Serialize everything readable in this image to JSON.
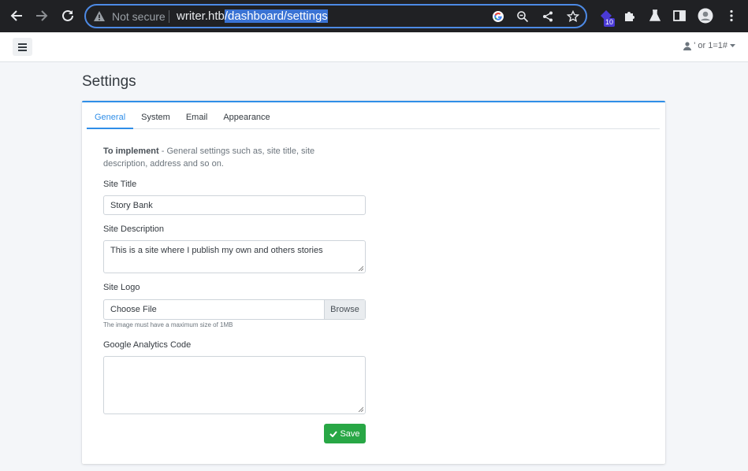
{
  "browser": {
    "security_label": "Not secure",
    "url_host": "writer.htb",
    "url_path": "/dashboard/settings",
    "extension_badge": "10",
    "icons": [
      "back-arrow-icon",
      "forward-arrow-icon",
      "reload-icon",
      "warning-icon",
      "google-icon",
      "zoom-icon",
      "share-icon",
      "star-icon",
      "extension-icon",
      "puzzle-icon",
      "flask-icon",
      "sidepanel-icon",
      "profile-icon",
      "kebab-menu-icon"
    ]
  },
  "navbar": {
    "user_label": "' or 1=1#",
    "icons": [
      "hamburger-icon",
      "user-icon",
      "caret-down-icon"
    ]
  },
  "page": {
    "title": "Settings",
    "tabs": [
      {
        "label": "General",
        "active": true
      },
      {
        "label": "System",
        "active": false
      },
      {
        "label": "Email",
        "active": false
      },
      {
        "label": "Appearance",
        "active": false
      }
    ]
  },
  "form": {
    "note_bold": "To implement",
    "note_text": " - General settings such as, site title, site description, address and so on.",
    "site_title_label": "Site Title",
    "site_title_value": "Story Bank",
    "site_description_label": "Site Description",
    "site_description_value": "This is a site where I publish my own and others stories",
    "site_logo_label": "Site Logo",
    "file_placeholder": "Choose File",
    "browse_label": "Browse",
    "logo_help": "The image must have a maximum size of 1MB",
    "analytics_label": "Google Analytics Code",
    "analytics_value": "",
    "save_label": "Save"
  },
  "colors": {
    "accent": "#2f8ee8",
    "save": "#28a745",
    "chrome_bg": "#202124",
    "omnibox_border": "#4d8ae5"
  }
}
